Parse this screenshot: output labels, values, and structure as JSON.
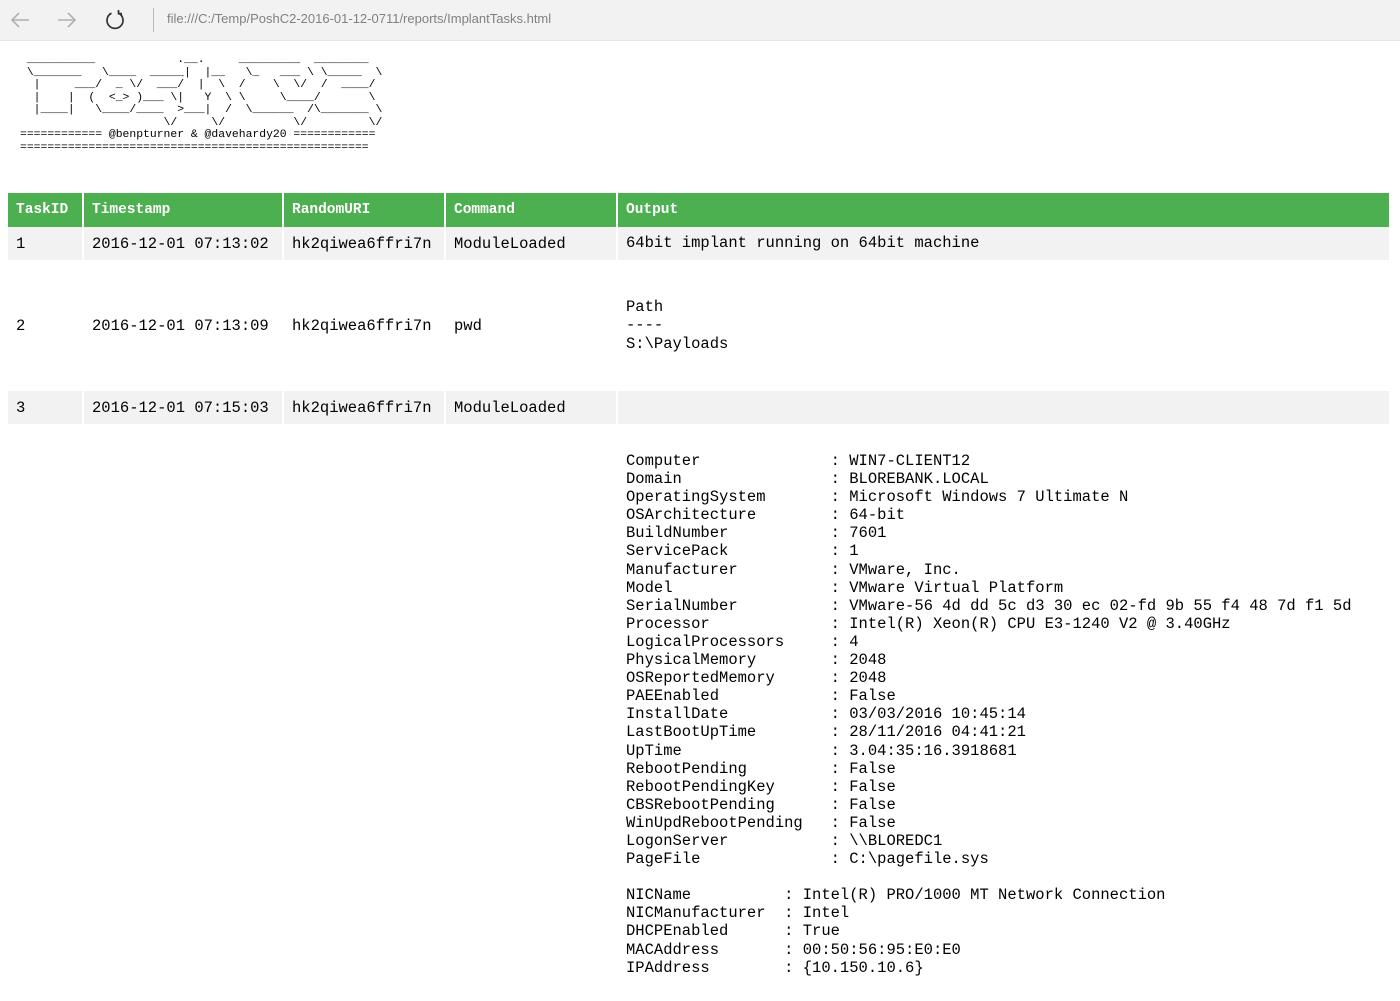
{
  "browser": {
    "back_icon": "arrow-left-icon",
    "forward_icon": "arrow-right-icon",
    "refresh_icon": "refresh-icon",
    "url": "file:///C:/Temp/PoshC2-2016-01-12-0711/reports/ImplantTasks.html"
  },
  "banner": {
    "ascii_logo": " __________            .__.     _________  ________  \n \\_______   \\____  _____|  |__   \\_   ___ \\ \\_____  \\ \n  |     ___/  _ \\/  ___/  |  \\  /    \\  \\/  /  ____/ \n  |    |  (  <_> )___ \\|   Y  \\ \\     \\____/       \\ \n  |____|   \\____/____  >___|  /  \\______  /\\_______ \\\n                     \\/     \\/          \\/         \\/",
    "credits": "============ @benpturner & @davehardy20 ============",
    "divider": "==================================================="
  },
  "table": {
    "headers": [
      "TaskID",
      "Timestamp",
      "RandomURI",
      "Command",
      "Output"
    ],
    "rows": [
      {
        "task_id": "1",
        "timestamp": "2016-12-01 07:13:02",
        "random_uri": "hk2qiwea6ffri7n",
        "command": "ModuleLoaded",
        "output": "64bit implant running on 64bit machine"
      },
      {
        "task_id": "2",
        "timestamp": "2016-12-01 07:13:09",
        "random_uri": "hk2qiwea6ffri7n",
        "command": "pwd",
        "output": "Path\n----\nS:\\Payloads"
      },
      {
        "task_id": "3",
        "timestamp": "2016-12-01 07:15:03",
        "random_uri": "hk2qiwea6ffri7n",
        "command": "ModuleLoaded",
        "output": ""
      },
      {
        "task_id": "",
        "timestamp": "",
        "random_uri": "",
        "command": "",
        "output": "Computer              : WIN7-CLIENT12\nDomain                : BLOREBANK.LOCAL\nOperatingSystem       : Microsoft Windows 7 Ultimate N\nOSArchitecture        : 64-bit\nBuildNumber           : 7601\nServicePack           : 1\nManufacturer          : VMware, Inc.\nModel                 : VMware Virtual Platform\nSerialNumber          : VMware-56 4d dd 5c d3 30 ec 02-fd 9b 55 f4 48 7d f1 5d\nProcessor             : Intel(R) Xeon(R) CPU E3-1240 V2 @ 3.40GHz\nLogicalProcessors     : 4\nPhysicalMemory        : 2048\nOSReportedMemory      : 2048\nPAEEnabled            : False\nInstallDate           : 03/03/2016 10:45:14\nLastBootUpTime        : 28/11/2016 04:41:21\nUpTime                : 3.04:35:16.3918681\nRebootPending         : False\nRebootPendingKey      : False\nCBSRebootPending      : False\nWinUpdRebootPending   : False\nLogonServer           : \\\\BLOREDC1\nPageFile              : C:\\pagefile.sys\n\nNICName          : Intel(R) PRO/1000 MT Network Connection\nNICManufacturer  : Intel\nDHCPEnabled      : True\nMACAddress       : 00:50:56:95:E0:E0\nIPAddress        : {10.150.10.6}"
      }
    ]
  },
  "colors": {
    "header_bg": "#4caf50",
    "header_text": "#ffffff",
    "stripe_bg": "#f2f2f2"
  }
}
